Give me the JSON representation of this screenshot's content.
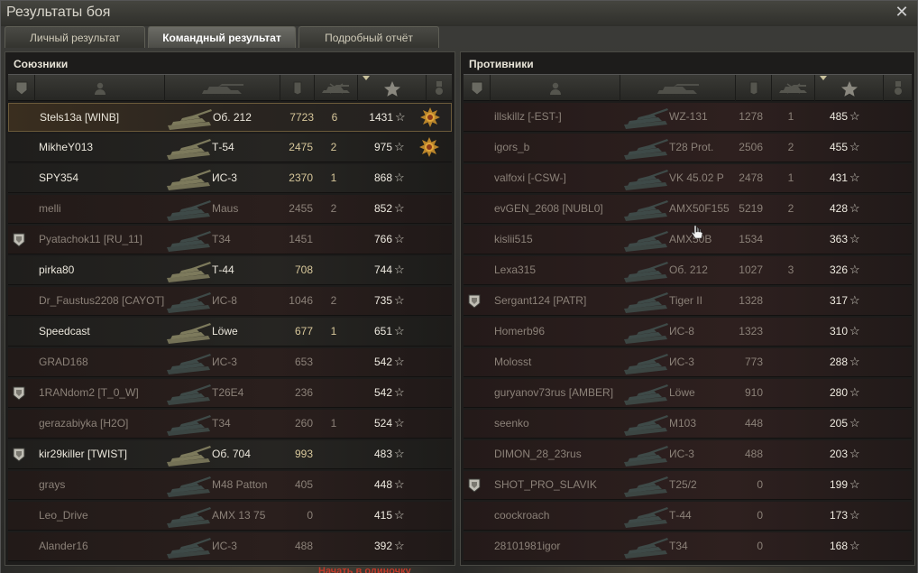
{
  "window": {
    "title": "Результаты боя"
  },
  "tabs": [
    {
      "label": "Личный результат"
    },
    {
      "label": "Командный результат"
    },
    {
      "label": "Подробный отчёт"
    }
  ],
  "allies": {
    "title": "Союзники",
    "rows": [
      {
        "player": "Stels13a [WINB]",
        "vehicle": "Об. 212",
        "damage": "7723",
        "kills": "6",
        "xp": "1431",
        "alive": true,
        "me": true,
        "medal": true,
        "badge": false
      },
      {
        "player": "MikheY013",
        "vehicle": "Т-54",
        "damage": "2475",
        "kills": "2",
        "xp": "975",
        "alive": true,
        "medal": true,
        "badge": false
      },
      {
        "player": "SPY354",
        "vehicle": "ИС-3",
        "damage": "2370",
        "kills": "1",
        "xp": "868",
        "alive": true,
        "badge": false
      },
      {
        "player": "melli",
        "vehicle": "Maus",
        "damage": "2455",
        "kills": "2",
        "xp": "852",
        "alive": false,
        "badge": false
      },
      {
        "player": "Pyatachok11 [RU_11]",
        "vehicle": "T34",
        "damage": "1451",
        "kills": "",
        "xp": "766",
        "alive": false,
        "badge": true
      },
      {
        "player": "pirka80",
        "vehicle": "Т-44",
        "damage": "708",
        "kills": "",
        "xp": "744",
        "alive": true,
        "badge": false
      },
      {
        "player": "Dr_Faustus2208 [CAYOT]",
        "vehicle": "ИС-8",
        "damage": "1046",
        "kills": "2",
        "xp": "735",
        "alive": false,
        "badge": false
      },
      {
        "player": "Speedcast",
        "vehicle": "Löwe",
        "damage": "677",
        "kills": "1",
        "xp": "651",
        "alive": true,
        "badge": false
      },
      {
        "player": "GRAD168",
        "vehicle": "ИС-3",
        "damage": "653",
        "kills": "",
        "xp": "542",
        "alive": false,
        "badge": false
      },
      {
        "player": "1RANdom2 [T_0_W]",
        "vehicle": "T26E4",
        "damage": "236",
        "kills": "",
        "xp": "542",
        "alive": false,
        "badge": true
      },
      {
        "player": "gerazabiyka [H2O]",
        "vehicle": "T34",
        "damage": "260",
        "kills": "1",
        "xp": "524",
        "alive": false,
        "badge": false
      },
      {
        "player": "kir29killer [TWIST]",
        "vehicle": "Об. 704",
        "damage": "993",
        "kills": "",
        "xp": "483",
        "alive": true,
        "badge": true
      },
      {
        "player": "grays",
        "vehicle": "M48 Patton",
        "damage": "405",
        "kills": "",
        "xp": "448",
        "alive": false,
        "badge": false
      },
      {
        "player": "Leo_Drive",
        "vehicle": "AMX 13 75",
        "damage": "0",
        "kills": "",
        "xp": "415",
        "alive": false,
        "badge": false
      },
      {
        "player": "Alander16",
        "vehicle": "ИС-3",
        "damage": "488",
        "kills": "",
        "xp": "392",
        "alive": false,
        "badge": false
      }
    ]
  },
  "enemies": {
    "title": "Противники",
    "rows": [
      {
        "player": "illskillz [-EST-]",
        "vehicle": "WZ-131",
        "damage": "1278",
        "kills": "1",
        "xp": "485",
        "badge": false
      },
      {
        "player": "igors_b",
        "vehicle": "T28 Prot.",
        "damage": "2506",
        "kills": "2",
        "xp": "455",
        "badge": false
      },
      {
        "player": "valfoxi [-CSW-]",
        "vehicle": "VK 45.02 P",
        "damage": "2478",
        "kills": "1",
        "xp": "431",
        "badge": false
      },
      {
        "player": "evGEN_2608 [NUBL0]",
        "vehicle": "AMX50F155",
        "damage": "5219",
        "kills": "2",
        "xp": "428",
        "badge": false
      },
      {
        "player": "kislii515",
        "vehicle": "AMX50B",
        "damage": "1534",
        "kills": "",
        "xp": "363",
        "badge": false
      },
      {
        "player": "Lexa315",
        "vehicle": "Об. 212",
        "damage": "1027",
        "kills": "3",
        "xp": "326",
        "badge": false
      },
      {
        "player": "Sergant124 [PATR]",
        "vehicle": "Tiger II",
        "damage": "1328",
        "kills": "",
        "xp": "317",
        "badge": true
      },
      {
        "player": "Homerb96",
        "vehicle": "ИС-8",
        "damage": "1323",
        "kills": "",
        "xp": "310",
        "badge": false
      },
      {
        "player": "Molosst",
        "vehicle": "ИС-3",
        "damage": "773",
        "kills": "",
        "xp": "288",
        "badge": false
      },
      {
        "player": "guryanov73rus [AMBER]",
        "vehicle": "Löwe",
        "damage": "910",
        "kills": "",
        "xp": "280",
        "badge": false
      },
      {
        "player": "seenko",
        "vehicle": "M103",
        "damage": "448",
        "kills": "",
        "xp": "205",
        "badge": false
      },
      {
        "player": "DIMON_28_23rus",
        "vehicle": "ИС-3",
        "damage": "488",
        "kills": "",
        "xp": "203",
        "badge": false
      },
      {
        "player": "SHOT_PRO_SLAVIK",
        "vehicle": "T25/2",
        "damage": "0",
        "kills": "",
        "xp": "199",
        "badge": true
      },
      {
        "player": "coockroach",
        "vehicle": "Т-44",
        "damage": "0",
        "kills": "",
        "xp": "173",
        "badge": false
      },
      {
        "player": "28101981igor",
        "vehicle": "T34",
        "damage": "0",
        "kills": "",
        "xp": "168",
        "badge": false
      }
    ]
  },
  "footer": {
    "text": "Начать в одиночку"
  },
  "icons": {
    "close": "close-icon",
    "badge": "clan-badge-icon",
    "medal": "medal-icon",
    "star": "star-icon"
  }
}
